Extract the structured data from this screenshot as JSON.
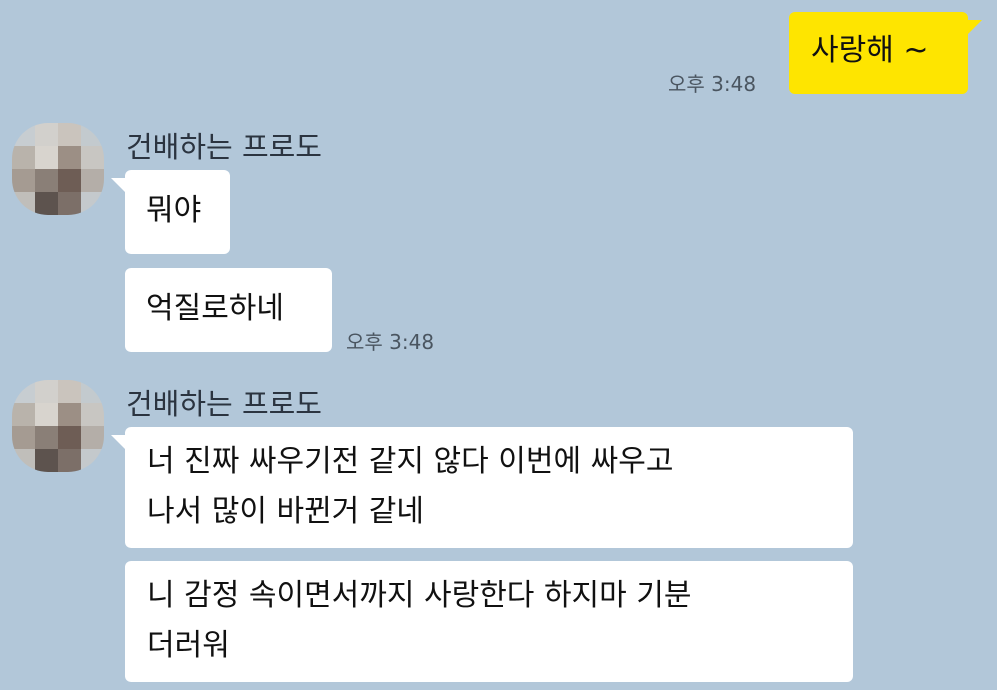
{
  "conversation": {
    "outgoing_1": {
      "text": "사랑해 ~",
      "time": "오후 3:48"
    },
    "group_1": {
      "sender": "건배하는 프로도",
      "messages": [
        "뭐야",
        "억질로하네"
      ],
      "time": "오후 3:48"
    },
    "group_2": {
      "sender": "건배하는 프로도",
      "messages": [
        "너 진짜 싸우기전 같지 않다 이번에 싸우고\n나서 많이 바뀐거 같네",
        "니 감정 속이면서까지 사랑한다 하지마 기분\n더러워"
      ]
    }
  },
  "colors": {
    "background": "#b2c7d9",
    "outgoing_bubble": "#fee500",
    "incoming_bubble": "#ffffff"
  }
}
